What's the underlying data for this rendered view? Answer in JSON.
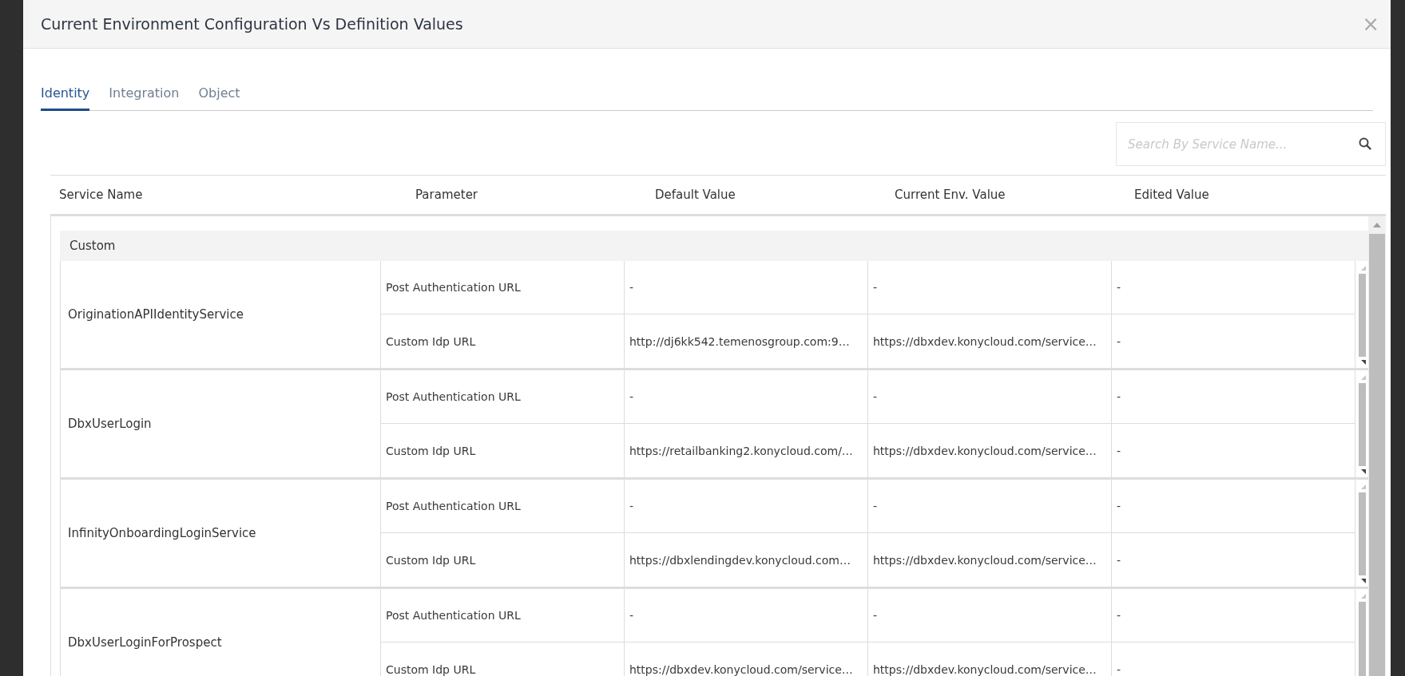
{
  "window": {
    "title": "Current Environment Configuration Vs Definition Values",
    "close": "×"
  },
  "tabs": [
    {
      "label": "Identity",
      "selected": true
    },
    {
      "label": "Integration",
      "selected": false
    },
    {
      "label": "Object",
      "selected": false
    }
  ],
  "search": {
    "placeholder": "Search By Service Name..."
  },
  "table": {
    "columns": [
      "Service Name",
      "Parameter",
      "Default Value",
      "Current Env. Value",
      "Edited Value"
    ],
    "groups": [
      {
        "name": "Custom",
        "services": [
          {
            "name": "OriginationAPIIdentityService",
            "rows": [
              {
                "parameter": "Post Authentication URL",
                "default_value": "-",
                "current_value": "-",
                "edited_value": "-"
              },
              {
                "parameter": "Custom Idp URL",
                "default_value": "http://dj6kk542.temenosgroup.com:9…",
                "current_value": "https://dbxdev.konycloud.com/service…",
                "edited_value": "-"
              }
            ]
          },
          {
            "name": "DbxUserLogin",
            "rows": [
              {
                "parameter": "Post Authentication URL",
                "default_value": "-",
                "current_value": "-",
                "edited_value": "-"
              },
              {
                "parameter": "Custom Idp URL",
                "default_value": "https://retailbanking2.konycloud.com/…",
                "current_value": "https://dbxdev.konycloud.com/service…",
                "edited_value": "-"
              }
            ]
          },
          {
            "name": "InfinityOnboardingLoginService",
            "rows": [
              {
                "parameter": "Post Authentication URL",
                "default_value": "-",
                "current_value": "-",
                "edited_value": "-"
              },
              {
                "parameter": "Custom Idp URL",
                "default_value": "https://dbxlendingdev.konycloud.com…",
                "current_value": "https://dbxdev.konycloud.com/service…",
                "edited_value": "-"
              }
            ]
          },
          {
            "name": "DbxUserLoginForProspect",
            "rows": [
              {
                "parameter": "Post Authentication URL",
                "default_value": "-",
                "current_value": "-",
                "edited_value": "-"
              },
              {
                "parameter": "Custom Idp URL",
                "default_value": "https://dbxdev.konycloud.com/service…",
                "current_value": "https://dbxdev.konycloud.com/service…",
                "edited_value": "-"
              }
            ]
          }
        ]
      }
    ]
  }
}
